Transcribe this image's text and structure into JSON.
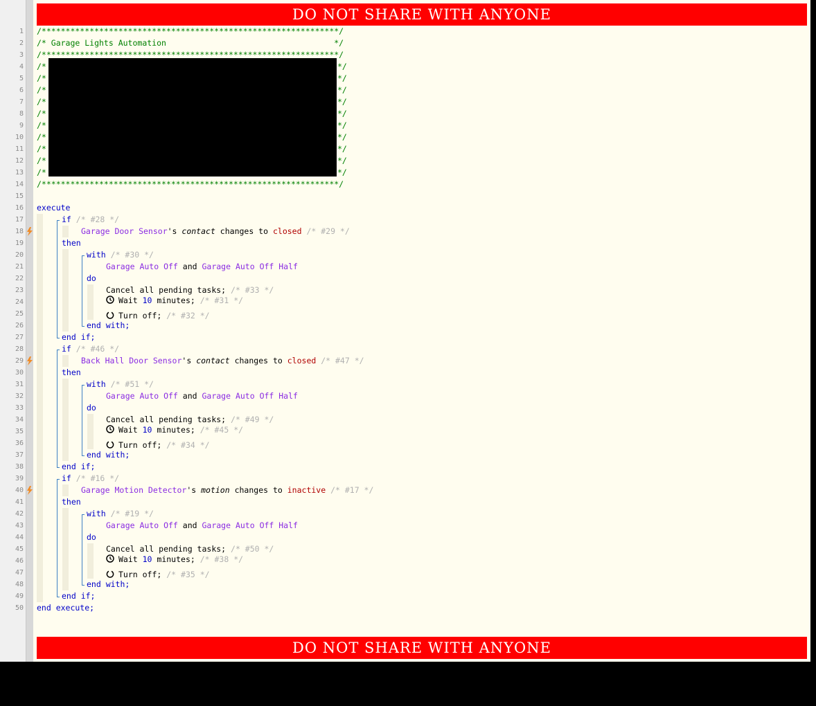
{
  "banner": {
    "top": "DO NOT SHARE WITH ANYONE",
    "bottom": "DO NOT SHARE WITH ANYONE"
  },
  "header_comments": {
    "line1": "/**************************************************************/",
    "line2": "/* Garage Lights Automation                                   */",
    "line3": "/**************************************************************/",
    "redacted_start": "/*",
    "redacted_end": "*/",
    "line14": "/**************************************************************/"
  },
  "code": {
    "execute": "execute",
    "end_execute": "end execute;",
    "blocks": [
      {
        "if": "if",
        "if_cm": "/* #28 */",
        "device": "Garage Door Sensor",
        "poss": "'s ",
        "attr": "contact",
        "changes": " changes to ",
        "state": "closed",
        "cond_cm": "/* #29 */",
        "then": "then",
        "with": "with",
        "with_cm": "/* #30 */",
        "dev1": "Garage Auto Off",
        "and": " and ",
        "dev2": "Garage Auto Off Half",
        "do": "do",
        "cancel": "Cancel all pending tasks;",
        "cancel_cm": "/* #33 */",
        "wait": "Wait ",
        "wait_num": "10",
        "wait_unit": " minutes;",
        "wait_cm": "/* #31 */",
        "off": "Turn off;",
        "off_cm": "/* #32 */",
        "end_with": "end with;",
        "end_if": "end if;"
      },
      {
        "if": "if",
        "if_cm": "/* #46 */",
        "device": "Back Hall Door Sensor",
        "poss": "'s ",
        "attr": "contact",
        "changes": " changes to ",
        "state": "closed",
        "cond_cm": "/* #47 */",
        "then": "then",
        "with": "with",
        "with_cm": "/* #51 */",
        "dev1": "Garage Auto Off",
        "and": " and ",
        "dev2": "Garage Auto Off Half",
        "do": "do",
        "cancel": "Cancel all pending tasks;",
        "cancel_cm": "/* #49 */",
        "wait": "Wait ",
        "wait_num": "10",
        "wait_unit": " minutes;",
        "wait_cm": "/* #45 */",
        "off": "Turn off;",
        "off_cm": "/* #34 */",
        "end_with": "end with;",
        "end_if": "end if;"
      },
      {
        "if": "if",
        "if_cm": "/* #16 */",
        "device": "Garage Motion Detector",
        "poss": "'s ",
        "attr": "motion",
        "changes": " changes to ",
        "state": "inactive",
        "cond_cm": "/* #17 */",
        "then": "then",
        "with": "with",
        "with_cm": "/* #19 */",
        "dev1": "Garage Auto Off",
        "and": " and ",
        "dev2": "Garage Auto Off Half",
        "do": "do",
        "cancel": "Cancel all pending tasks;",
        "cancel_cm": "/* #50 */",
        "wait": "Wait ",
        "wait_num": "10",
        "wait_unit": " minutes;",
        "wait_cm": "/* #38 */",
        "off": "Turn off;",
        "off_cm": "/* #35 */",
        "end_with": "end with;",
        "end_if": "end if;"
      }
    ]
  },
  "line_numbers": [
    "1",
    "2",
    "3",
    "4",
    "5",
    "6",
    "7",
    "8",
    "9",
    "10",
    "11",
    "12",
    "13",
    "14",
    "15",
    "16",
    "17",
    "18",
    "19",
    "20",
    "21",
    "22",
    "23",
    "24",
    "25",
    "26",
    "27",
    "28",
    "29",
    "30",
    "31",
    "32",
    "33",
    "34",
    "35",
    "36",
    "37",
    "38",
    "39",
    "40",
    "41",
    "42",
    "43",
    "44",
    "45",
    "46",
    "47",
    "48",
    "49",
    "50"
  ],
  "colors": {
    "banner": "#ff0000",
    "comment": "#008000",
    "keyword": "#0000c8",
    "device": "#8a2be2",
    "state": "#b00000",
    "trigger_bolt": "#f08c28"
  },
  "icons": {
    "trigger": "lightning-bolt-icon",
    "wait": "clock-icon",
    "off": "power-icon"
  }
}
